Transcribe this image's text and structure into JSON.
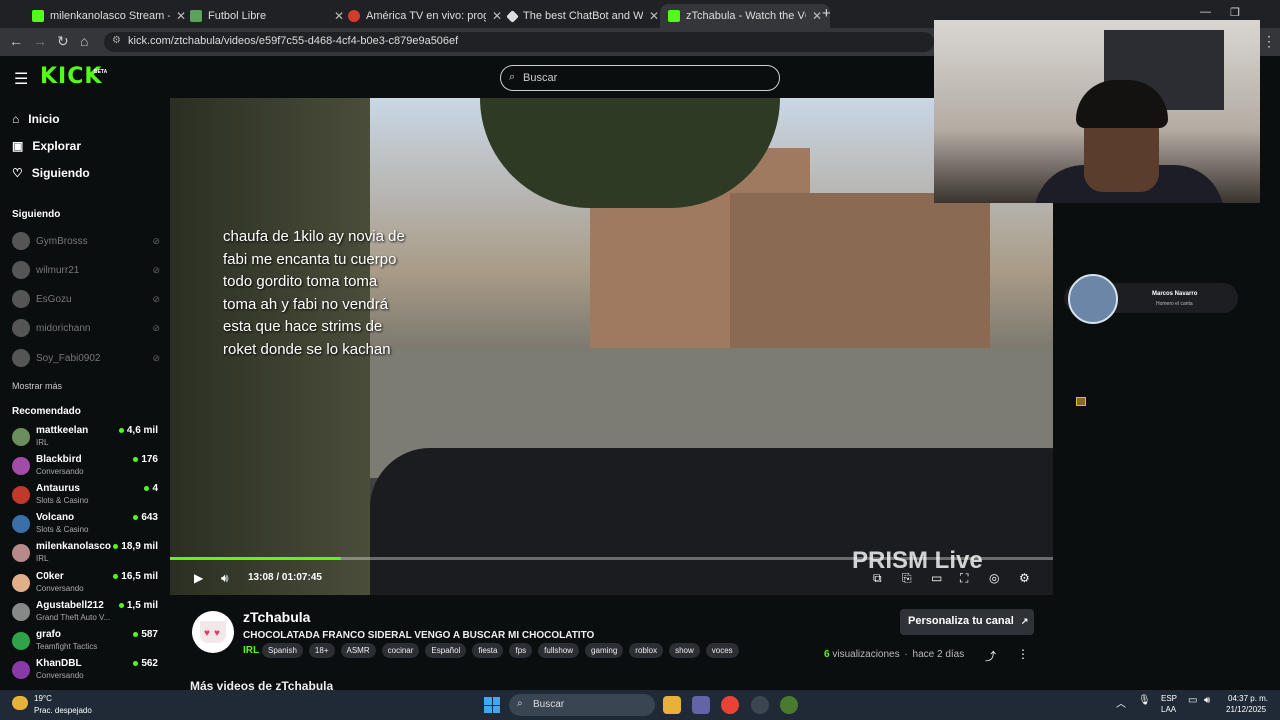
{
  "browser": {
    "tabs": [
      {
        "title": "milenkanolasco Stream - Watch",
        "color": "#53fc18"
      },
      {
        "title": "Futbol Libre",
        "color": "#5aa35a"
      },
      {
        "title": "América TV en vivo: programac",
        "color": "#d33b2c"
      },
      {
        "title": "The best ChatBot and Widgets",
        "color": "#dddddd"
      },
      {
        "title": "zTchabula - Watch the VOD on",
        "color": "#53fc18"
      }
    ],
    "url": "kick.com/ztchabula/videos/e59f7c55-d468-4cf4-b0e3-c879e9a506ef"
  },
  "site": {
    "logo": "KICK",
    "logo_badge": "BETA",
    "search_placeholder": "Buscar"
  },
  "sidebar": {
    "nav": [
      {
        "label": "Inicio",
        "icon": "home-icon"
      },
      {
        "label": "Explorar",
        "icon": "explore-icon"
      },
      {
        "label": "Siguiendo",
        "icon": "heart-icon"
      }
    ],
    "following_header": "Siguiendo",
    "following": [
      "GymBrosss",
      "wilmurr21",
      "EsGozu",
      "midorichann",
      "Soy_Fabi0902"
    ],
    "show_more": "Mostrar más",
    "recommended_header": "Recomendado",
    "recommended": [
      {
        "name": "mattkeelan",
        "category": "IRL",
        "viewers": "4,6 mil",
        "color": "#6b8f5a"
      },
      {
        "name": "Blackbird",
        "category": "Conversando",
        "viewers": "176",
        "color": "#a24ba8"
      },
      {
        "name": "Antaurus",
        "category": "Slots & Casino",
        "viewers": "4",
        "color": "#c0392b"
      },
      {
        "name": "Volcano",
        "category": "Slots & Casino",
        "viewers": "643",
        "color": "#3b6fa8"
      },
      {
        "name": "milenkanolasco",
        "category": "IRL",
        "viewers": "18,9 mil",
        "color": "#b8898a"
      },
      {
        "name": "C0ker",
        "category": "Conversando",
        "viewers": "16,5 mil",
        "color": "#e0b08a"
      },
      {
        "name": "Agustabell212",
        "category": "Grand Theft Auto V...",
        "viewers": "1,5 mil",
        "color": "#888888"
      },
      {
        "name": "grafo",
        "category": "Teamfight Tactics",
        "viewers": "587",
        "color": "#2ea34a"
      },
      {
        "name": "KhanDBL",
        "category": "Conversando",
        "viewers": "562",
        "color": "#8a3aa8"
      }
    ]
  },
  "player": {
    "caption": "chaufa de 1kilo ay novia de fabi me encanta tu cuerpo todo gordito toma toma toma ah y fabi no vendrá esta que hace strims de roket donde se lo kachan",
    "time": "13:08 / 01:07:45",
    "progress": 0.194,
    "watermark": "PRISM Live"
  },
  "overlay": {
    "name": "Marcos Navarro",
    "sub": "Homero el canta"
  },
  "channel": {
    "name": "zTchabula",
    "title": "CHOCOLATADA FRANCO SIDERAL VENGO A BUSCAR MI CHOCOLATITO",
    "category": "IRL",
    "tags": [
      "Spanish",
      "18+",
      "ASMR",
      "cocinar",
      "Español",
      "fiesta",
      "fps",
      "fullshow",
      "gaming",
      "roblox",
      "show",
      "voces"
    ],
    "customize": "Personaliza tu canal",
    "views_count": "6",
    "views_label": "visualizaciones",
    "ago": "hace 2 días",
    "more_videos": "Más videos de zTchabula"
  },
  "taskbar": {
    "temp": "19°C",
    "weather": "Prac. despejado",
    "search": "Buscar",
    "lang1": "ESP",
    "lang2": "LAA",
    "time": "04:37 p. m.",
    "date": "21/12/2025"
  }
}
